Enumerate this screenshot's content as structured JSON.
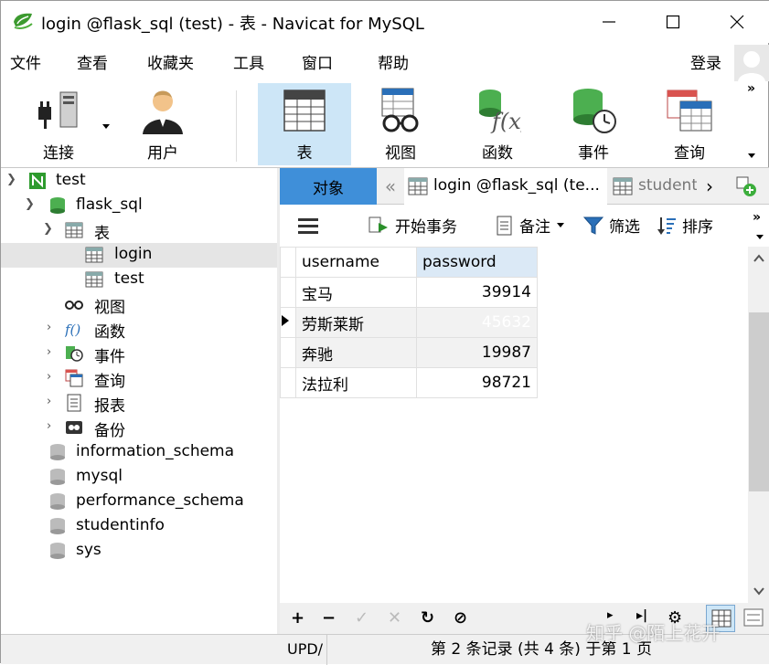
{
  "window": {
    "title": "login @flask_sql (test) - 表 - Navicat for MySQL"
  },
  "menubar": {
    "items": [
      "文件",
      "查看",
      "收藏夹",
      "工具",
      "窗口",
      "帮助"
    ],
    "login_label": "登录"
  },
  "toolbar": {
    "buttons": [
      "连接",
      "用户",
      "表",
      "视图",
      "函数",
      "事件",
      "查询"
    ],
    "active": "表"
  },
  "tree": {
    "connection": "test",
    "database": "flask_sql",
    "tables_group": "表",
    "tables": [
      "login",
      "test"
    ],
    "selected_table": "login",
    "groups": [
      "视图",
      "函数",
      "事件",
      "查询",
      "报表",
      "备份"
    ],
    "other_databases": [
      "information_schema",
      "mysql",
      "performance_schema",
      "studentinfo",
      "sys"
    ]
  },
  "tabs": {
    "objects": "对象",
    "login_tab": "login @flask_sql (te...",
    "student_tab": "student"
  },
  "grid_toolbar": {
    "begin_transaction": "开始事务",
    "note": "备注",
    "filter": "筛选",
    "sort": "排序"
  },
  "grid": {
    "columns": [
      "username",
      "password"
    ],
    "rows": [
      [
        "宝马",
        "39914"
      ],
      [
        "劳斯莱斯",
        "45632"
      ],
      [
        "奔驰",
        "19987"
      ],
      [
        "法拉利",
        "98721"
      ]
    ],
    "selected_row": 1,
    "selected_col": 1
  },
  "statusbar": {
    "sql_preview": "UPD/",
    "record_info": "第 2 条记录 (共 4 条) 于第 1 页"
  },
  "watermark": "知乎 @陌上花开",
  "colors": {
    "active_tab": "#3f8fd9",
    "selection": "#0a74d9",
    "toolbar_active": "#cde6f7"
  }
}
